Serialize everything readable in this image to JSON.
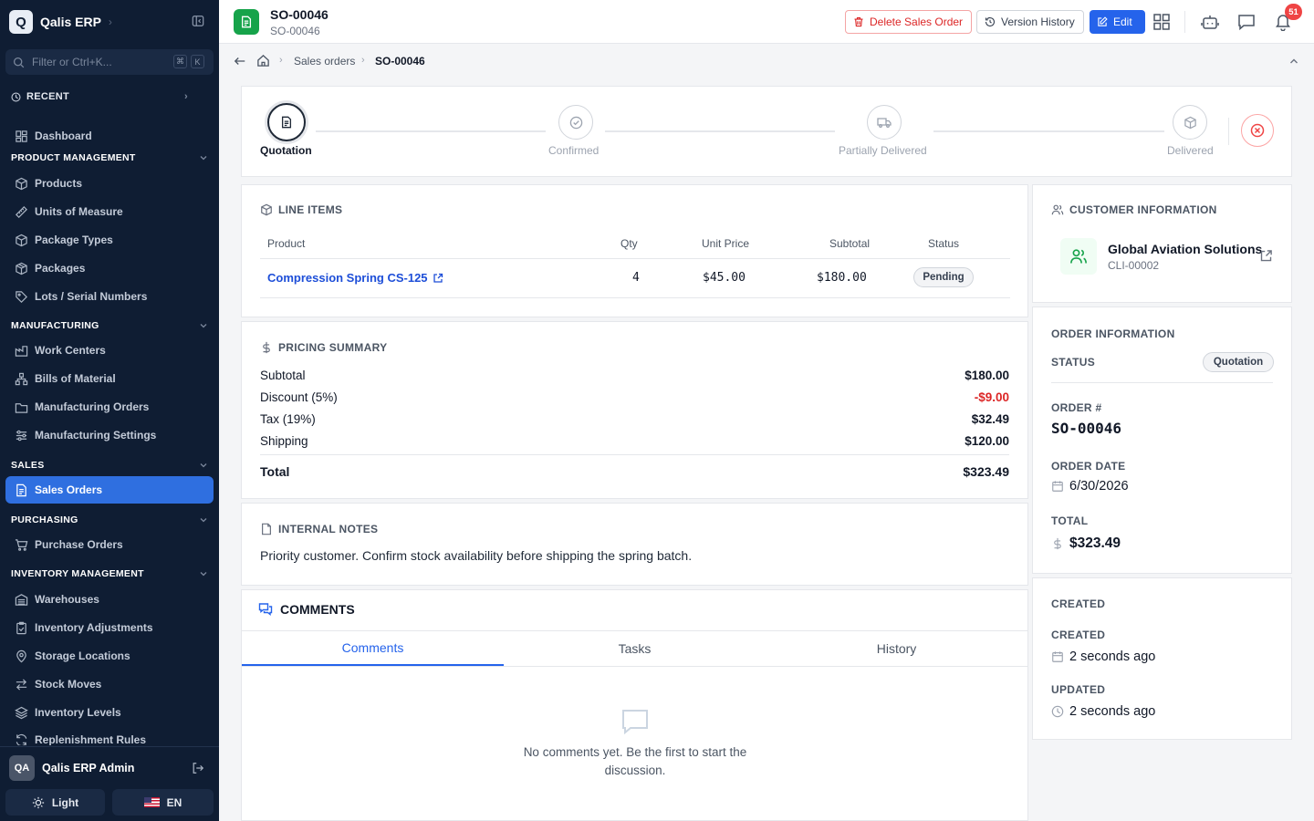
{
  "app": {
    "logo_letter": "Q",
    "name": "Qalis ERP"
  },
  "sidebar": {
    "filter_placeholder": "Filter or Ctrl+K...",
    "filter_keys": [
      "⌘",
      "K"
    ],
    "recent_label": "RECENT",
    "dashboard": "Dashboard",
    "sections": {
      "product": {
        "label": "PRODUCT MANAGEMENT",
        "items": [
          "Products",
          "Units of Measure",
          "Package Types",
          "Packages",
          "Lots / Serial Numbers"
        ]
      },
      "manufacturing": {
        "label": "MANUFACTURING",
        "items": [
          "Work Centers",
          "Bills of Material",
          "Manufacturing Orders",
          "Manufacturing Settings"
        ]
      },
      "sales": {
        "label": "SALES",
        "items": [
          "Sales Orders"
        ]
      },
      "purchasing": {
        "label": "PURCHASING",
        "items": [
          "Purchase Orders"
        ]
      },
      "inventory": {
        "label": "INVENTORY MANAGEMENT",
        "items": [
          "Warehouses",
          "Inventory Adjustments",
          "Storage Locations",
          "Stock Moves",
          "Inventory Levels",
          "Replenishment Rules"
        ]
      }
    },
    "active_item": "Sales Orders",
    "user": {
      "initials": "QA",
      "name": "Qalis ERP Admin"
    },
    "theme_label": "Light",
    "language_label": "EN"
  },
  "header": {
    "title": "SO-00046",
    "subtitle": "SO-00046",
    "delete_label": "Delete Sales Order",
    "history_label": "Version History",
    "edit_label": "Edit",
    "notification_count": "51"
  },
  "breadcrumb": {
    "items": [
      "Sales orders",
      "SO-00046"
    ]
  },
  "stepper": {
    "steps": [
      "Quotation",
      "Confirmed",
      "Partially Delivered",
      "Delivered"
    ],
    "current": "Quotation"
  },
  "line_items": {
    "title": "LINE ITEMS",
    "headers": [
      "Product",
      "Qty",
      "Unit Price",
      "Subtotal",
      "Status"
    ],
    "rows": [
      {
        "product": "Compression Spring CS-125",
        "qty": "4",
        "unit_price": "$45.00",
        "subtotal": "$180.00",
        "status": "Pending"
      }
    ]
  },
  "pricing": {
    "title": "PRICING SUMMARY",
    "rows": [
      {
        "label": "Subtotal",
        "value": "$180.00"
      },
      {
        "label": "Discount (5%)",
        "value": "-$9.00"
      },
      {
        "label": "Tax (19%)",
        "value": "$32.49"
      },
      {
        "label": "Shipping",
        "value": "$120.00"
      }
    ],
    "total_label": "Total",
    "total_value": "$323.49"
  },
  "notes": {
    "title": "INTERNAL NOTES",
    "text": "Priority customer. Confirm stock availability before shipping the spring batch."
  },
  "comments": {
    "title": "COMMENTS",
    "tabs": [
      "Comments",
      "Tasks",
      "History"
    ],
    "active_tab": "Comments",
    "empty_text": "No comments yet. Be the first to start the discussion."
  },
  "customer": {
    "title": "CUSTOMER INFORMATION",
    "name": "Global Aviation Solutions",
    "id": "CLI-00002"
  },
  "order_info": {
    "title": "ORDER INFORMATION",
    "status_label": "STATUS",
    "status_value": "Quotation",
    "order_no_label": "ORDER #",
    "order_no": "SO-00046",
    "date_label": "ORDER DATE",
    "date": "6/30/2026",
    "total_label": "TOTAL",
    "total": "$323.49"
  },
  "created": {
    "title": "CREATED",
    "created_label": "CREATED",
    "created_value": "2 seconds ago",
    "updated_label": "UPDATED",
    "updated_value": "2 seconds ago"
  },
  "colors": {
    "accent": "#2563eb",
    "sidebar": "#0f1d33",
    "danger": "#dc2626",
    "success": "#16a34a"
  }
}
